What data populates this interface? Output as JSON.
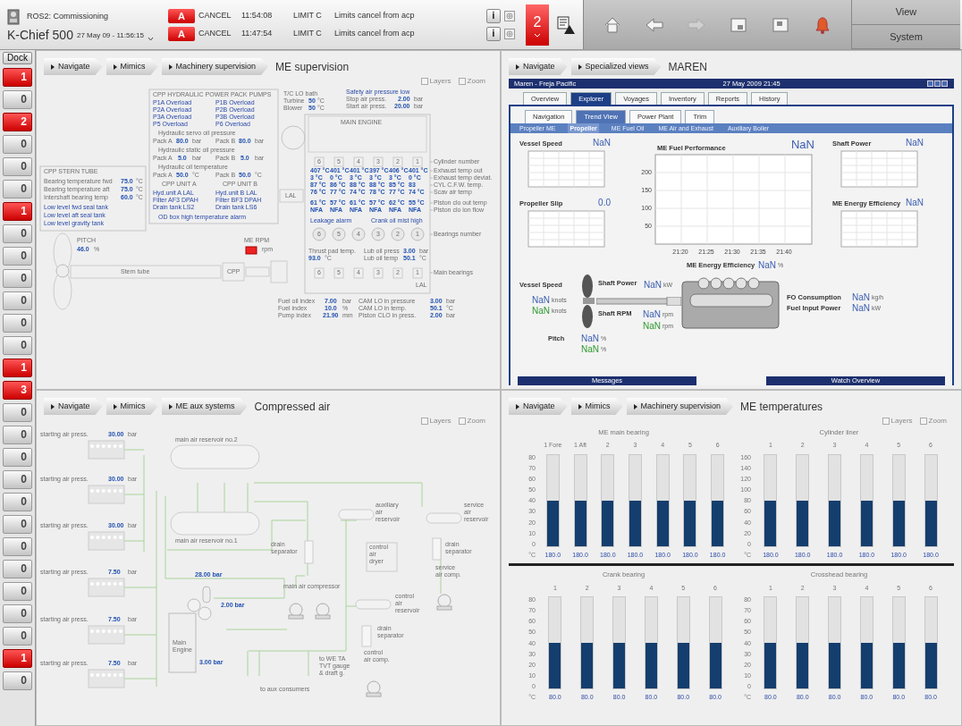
{
  "top_bar": {
    "system": "ROS2: Commissioning",
    "product": "K-Chief 500",
    "datetime": "27 May 09 - 11:56:15",
    "alarms": [
      {
        "badge": "A",
        "action": "CANCEL",
        "time": "11:54:08",
        "type": "LIMIT C",
        "message": "Limits cancel from acp"
      },
      {
        "badge": "A",
        "action": "CANCEL",
        "time": "11:47:54",
        "type": "LIMIT C",
        "message": "Limits cancel from acp"
      }
    ],
    "info": [
      "i",
      "i"
    ],
    "alarm_count": "2",
    "toolbar": [
      {
        "kind": "home",
        "disabled": false
      },
      {
        "kind": "back",
        "disabled": false
      },
      {
        "kind": "forward",
        "disabled": true
      },
      {
        "kind": "window",
        "disabled": false
      },
      {
        "kind": "window-list",
        "disabled": false
      },
      {
        "kind": "bell",
        "disabled": false
      }
    ],
    "menu": [
      "View",
      "System"
    ]
  },
  "dock": {
    "label": "Dock",
    "counters": [
      {
        "count": "1",
        "alarm": true
      },
      {
        "count": "0",
        "alarm": false
      },
      {
        "count": "2",
        "alarm": true
      },
      {
        "count": "0",
        "alarm": false
      },
      {
        "count": "0",
        "alarm": false
      },
      {
        "count": "0",
        "alarm": false
      },
      {
        "count": "1",
        "alarm": true
      },
      {
        "count": "0",
        "alarm": false
      },
      {
        "count": "0",
        "alarm": false
      },
      {
        "count": "0",
        "alarm": false
      },
      {
        "count": "0",
        "alarm": false
      },
      {
        "count": "0",
        "alarm": false
      },
      {
        "count": "0",
        "alarm": false
      },
      {
        "count": "1",
        "alarm": true
      },
      {
        "count": "3",
        "alarm": true
      },
      {
        "count": "0",
        "alarm": false
      },
      {
        "count": "0",
        "alarm": false
      },
      {
        "count": "0",
        "alarm": false
      },
      {
        "count": "0",
        "alarm": false
      },
      {
        "count": "0",
        "alarm": false
      },
      {
        "count": "0",
        "alarm": false
      },
      {
        "count": "0",
        "alarm": false
      },
      {
        "count": "0",
        "alarm": false
      },
      {
        "count": "0",
        "alarm": false
      },
      {
        "count": "0",
        "alarm": false
      },
      {
        "count": "0",
        "alarm": false
      },
      {
        "count": "1",
        "alarm": true
      },
      {
        "count": "0",
        "alarm": false
      }
    ]
  },
  "me_supervision": {
    "breadcrumb": [
      "Navigate",
      "Mimics",
      "Machinery supervision"
    ],
    "title": "ME supervision",
    "options": [
      {
        "label": "Layers",
        "checked": false
      },
      {
        "label": "Zoom",
        "checked": false
      }
    ],
    "labels": [
      {
        "text": "CPP HYDRAULIC POWER PACK PUMPS",
        "kind": "caption"
      },
      {
        "text": "P1A Overload",
        "kind": "alarm"
      },
      {
        "text": "P1B Overload",
        "kind": "alarm"
      },
      {
        "text": "P2A Overload",
        "kind": "alarm"
      },
      {
        "text": "P2B Overload",
        "kind": "alarm"
      },
      {
        "text": "P3A Overload",
        "kind": "alarm"
      },
      {
        "text": "P3B Overload",
        "kind": "alarm"
      },
      {
        "text": "P5 Overload",
        "kind": "alarm"
      },
      {
        "text": "P6 Overload",
        "kind": "alarm"
      },
      {
        "text": "Hydraulic servo oil pressure",
        "kind": "caption"
      },
      {
        "text": "Pack A",
        "kind": "caption"
      },
      {
        "text": "80.0",
        "kind": "value"
      },
      {
        "text": "bar",
        "kind": "unit"
      },
      {
        "text": "Pack B",
        "kind": "caption"
      },
      {
        "text": "80.0",
        "kind": "value"
      },
      {
        "text": "bar",
        "kind": "unit"
      },
      {
        "text": "Hydraulic static oil pressure",
        "kind": "caption"
      },
      {
        "text": "Pack A",
        "kind": "caption"
      },
      {
        "text": "5.0",
        "kind": "value"
      },
      {
        "text": "bar",
        "kind": "unit"
      },
      {
        "text": "Pack B",
        "kind": "caption"
      },
      {
        "text": "5.0",
        "kind": "value"
      },
      {
        "text": "bar",
        "kind": "unit"
      },
      {
        "text": "Hydraulic oil temperature",
        "kind": "caption"
      },
      {
        "text": "Pack A",
        "kind": "caption"
      },
      {
        "text": "50.0",
        "kind": "value"
      },
      {
        "text": "°C",
        "kind": "unit"
      },
      {
        "text": "Pack B",
        "kind": "caption"
      },
      {
        "text": "50.0",
        "kind": "value"
      },
      {
        "text": "°C",
        "kind": "unit"
      },
      {
        "text": "CPP UNIT A",
        "kind": "caption"
      },
      {
        "text": "CPP UNIT B",
        "kind": "caption"
      },
      {
        "text": "Hyd.unit A LAL",
        "kind": "alarm"
      },
      {
        "text": "Hyd.unit B LAL",
        "kind": "alarm"
      },
      {
        "text": "Filter AF3 DPAH",
        "kind": "alarm"
      },
      {
        "text": "Filter BF3 DPAH",
        "kind": "alarm"
      },
      {
        "text": "Drain tank LS2",
        "kind": "alarm"
      },
      {
        "text": "Drain tank LS6",
        "kind": "alarm"
      },
      {
        "text": "OD box high temperature alarm",
        "kind": "alarm"
      },
      {
        "text": "CPP STERN TUBE",
        "kind": "caption"
      },
      {
        "text": "Bearing temperature fwd",
        "kind": "caption"
      },
      {
        "text": "75.0",
        "kind": "value"
      },
      {
        "text": "°C",
        "kind": "unit"
      },
      {
        "text": "Bearing temperature aft",
        "kind": "caption"
      },
      {
        "text": "75.0",
        "kind": "value"
      },
      {
        "text": "°C",
        "kind": "unit"
      },
      {
        "text": "Intershaft bearing temp",
        "kind": "caption"
      },
      {
        "text": "60.0",
        "kind": "value"
      },
      {
        "text": "°C",
        "kind": "unit"
      },
      {
        "text": "Low level fwd seal tank",
        "kind": "alarm"
      },
      {
        "text": "Low level aft seal tank",
        "kind": "alarm"
      },
      {
        "text": "Low level gravity tank",
        "kind": "alarm"
      },
      {
        "text": "PITCH",
        "kind": "caption"
      },
      {
        "text": "46.0",
        "kind": "value"
      },
      {
        "text": "%",
        "kind": "unit"
      },
      {
        "text": "ME RPM",
        "kind": "caption"
      },
      {
        "text": "rpm",
        "kind": "unit"
      },
      {
        "text": "Stern tube",
        "kind": "caption"
      },
      {
        "text": "CPP",
        "kind": "caption"
      },
      {
        "text": "T/C LO bath",
        "kind": "caption"
      },
      {
        "text": "Turbine",
        "kind": "caption"
      },
      {
        "text": "50",
        "kind": "value"
      },
      {
        "text": "°C",
        "kind": "unit"
      },
      {
        "text": "Blower",
        "kind": "caption"
      },
      {
        "text": "50",
        "kind": "value"
      },
      {
        "text": "°C",
        "kind": "unit"
      },
      {
        "text": "Safety air pressure low",
        "kind": "alarm"
      },
      {
        "text": "Stop air press.",
        "kind": "caption"
      },
      {
        "text": "2.00",
        "kind": "value"
      },
      {
        "text": "bar",
        "kind": "unit"
      },
      {
        "text": "Start air press.",
        "kind": "caption"
      },
      {
        "text": "20.00",
        "kind": "value"
      },
      {
        "text": "bar",
        "kind": "unit"
      },
      {
        "text": "MAIN ENGINE",
        "kind": "caption"
      },
      {
        "text": "Cylinder number",
        "kind": "caption"
      },
      {
        "text": "Exhaust temp out",
        "kind": "caption"
      },
      {
        "text": "Exhaust temp deviat.",
        "kind": "caption"
      },
      {
        "text": "CYL C.F.W. temp.",
        "kind": "caption"
      },
      {
        "text": "Scav air temp",
        "kind": "caption"
      },
      {
        "text": "Piston clo out temp",
        "kind": "caption"
      },
      {
        "text": "Piston clo ion flow",
        "kind": "caption"
      },
      {
        "text": "Bearings number",
        "kind": "caption"
      },
      {
        "text": "Main bearings",
        "kind": "caption"
      },
      {
        "text": "Leakage alarm",
        "kind": "alarm"
      },
      {
        "text": "Crank oil mist high",
        "kind": "alarm"
      },
      {
        "text": "Thrust pad temp.",
        "kind": "caption"
      },
      {
        "text": "93.0",
        "kind": "value"
      },
      {
        "text": "°C",
        "kind": "unit"
      },
      {
        "text": "Lub oil press",
        "kind": "caption"
      },
      {
        "text": "3.00",
        "kind": "value"
      },
      {
        "text": "bar",
        "kind": "unit"
      },
      {
        "text": "Lub oil temp",
        "kind": "caption"
      },
      {
        "text": "50.1",
        "kind": "value"
      },
      {
        "text": "°C",
        "kind": "unit"
      },
      {
        "text": "Fuel oil index",
        "kind": "caption"
      },
      {
        "text": "7.00",
        "kind": "value"
      },
      {
        "text": "bar",
        "kind": "unit"
      },
      {
        "text": "Fuel index",
        "kind": "caption"
      },
      {
        "text": "10.0",
        "kind": "value"
      },
      {
        "text": "%",
        "kind": "unit"
      },
      {
        "text": "Pump index",
        "kind": "caption"
      },
      {
        "text": "21.90",
        "kind": "value"
      },
      {
        "text": "mm",
        "kind": "unit"
      },
      {
        "text": "CAM LO in pressure",
        "kind": "caption"
      },
      {
        "text": "3.00",
        "kind": "value"
      },
      {
        "text": "bar",
        "kind": "unit"
      },
      {
        "text": "CAM LO in temp.",
        "kind": "caption"
      },
      {
        "text": "50.1",
        "kind": "value"
      },
      {
        "text": "°C",
        "kind": "unit"
      },
      {
        "text": "Piston CLO in press.",
        "kind": "caption"
      },
      {
        "text": "2.00",
        "kind": "value"
      },
      {
        "text": "bar",
        "kind": "unit"
      },
      {
        "text": "LAL",
        "kind": "caption"
      },
      {
        "text": "LAL",
        "kind": "caption"
      }
    ],
    "engine_table": {
      "cylinders": [
        "6",
        "5",
        "4",
        "3",
        "2",
        "1"
      ],
      "rows": [
        [
          "407 °C",
          "401 °C",
          "401 °C",
          "397 °C",
          "406 °C",
          "401 °C"
        ],
        [
          "3 °C",
          "0 °C",
          "3 °C",
          "3 °C",
          "3 °C",
          "0 °C"
        ],
        [
          "87 °C",
          "86 °C",
          "88 °C",
          "88 °C",
          "85 °C",
          "83"
        ],
        [
          "76 °C",
          "77 °C",
          "74 °C",
          "78 °C",
          "77 °C",
          "74 °C"
        ],
        [
          "61 °C",
          "57 °C",
          "61 °C",
          "57 °C",
          "62 °C",
          "55 °C"
        ],
        [
          "NFA",
          "NFA",
          "NFA",
          "NFA",
          "NFA",
          "NFA"
        ]
      ],
      "bearings": [
        "6",
        "5",
        "4",
        "3",
        "2",
        "1"
      ],
      "main_bearings": [
        "6",
        "5",
        "4",
        "3",
        "2",
        "1"
      ]
    },
    "rpm_alarm": true
  },
  "maren": {
    "breadcrumb": [
      "Navigate",
      "Specialized views"
    ],
    "title": "MAREN",
    "app_title": "Maren - Freja Pacific",
    "app_datetime": "27 May 2009 21:45",
    "tabs": [
      {
        "label": "Overview",
        "selected": false
      },
      {
        "label": "Explorer",
        "selected": true
      },
      {
        "label": "Voyages",
        "selected": false
      },
      {
        "label": "Inventory",
        "selected": false
      },
      {
        "label": "Reports",
        "selected": false
      },
      {
        "label": "History",
        "selected": false
      }
    ],
    "subtabs": [
      {
        "label": "Navigation",
        "selected": false
      },
      {
        "label": "Trend View",
        "selected": true
      },
      {
        "label": "Power Plant",
        "selected": false
      },
      {
        "label": "Trim",
        "selected": false
      }
    ],
    "views": [
      {
        "label": "Propeller ME",
        "selected": false
      },
      {
        "label": "Propeller",
        "selected": true
      },
      {
        "label": "ME Fuel Oil",
        "selected": false
      },
      {
        "label": "ME Air and Exhaust",
        "selected": false
      },
      {
        "label": "Auxiliary Boiler",
        "selected": false
      }
    ],
    "trends": [
      {
        "title": "Vessel Speed",
        "value": "NaN"
      },
      {
        "title": "Propeller Slip",
        "value": "0.0"
      },
      {
        "title": "ME Fuel Performance",
        "value": "NaN",
        "yticks": [
          "200",
          "150",
          "100",
          "50"
        ],
        "xticks": [
          "21:20",
          "21:25",
          "21:30",
          "21:35",
          "21:40"
        ]
      },
      {
        "title": "Shaft Power",
        "value": "NaN"
      },
      {
        "title": "ME Energy Efficiency",
        "value": "NaN"
      }
    ],
    "readings": [
      {
        "label": "Vessel Speed",
        "values": [
          {
            "value": "NaN",
            "unit": "knots",
            "kind": "measured"
          },
          {
            "value": "NaN",
            "unit": "knots",
            "kind": "reference"
          }
        ]
      },
      {
        "label": "Shaft Power",
        "values": [
          {
            "value": "NaN",
            "unit": "kW",
            "kind": "measured"
          }
        ]
      },
      {
        "label": "Shaft RPM",
        "values": [
          {
            "value": "NaN",
            "unit": "rpm",
            "kind": "measured"
          },
          {
            "value": "NaN",
            "unit": "rpm",
            "kind": "reference"
          }
        ]
      },
      {
        "label": "Pitch",
        "values": [
          {
            "value": "NaN",
            "unit": "%",
            "kind": "measured"
          },
          {
            "value": "NaN",
            "unit": "%",
            "kind": "reference"
          }
        ]
      },
      {
        "label": "ME Energy Efficiency",
        "values": [
          {
            "value": "NaN",
            "unit": "%",
            "kind": "measured"
          }
        ]
      },
      {
        "label": "FO Consumption",
        "values": [
          {
            "value": "NaN",
            "unit": "kg/h",
            "kind": "measured"
          }
        ]
      },
      {
        "label": "Fuel Input Power",
        "values": [
          {
            "value": "NaN",
            "unit": "kW",
            "kind": "measured"
          }
        ]
      }
    ],
    "footer": [
      "Messages",
      "Watch Overview"
    ]
  },
  "compressed_air": {
    "breadcrumb": [
      "Navigate",
      "Mimics",
      "ME aux systems"
    ],
    "title": "Compressed air",
    "options": [
      {
        "label": "Layers",
        "checked": false
      },
      {
        "label": "Zoom",
        "checked": false
      }
    ],
    "starting_air": [
      {
        "label": "starting air press.",
        "value": "30.00",
        "unit": "bar"
      },
      {
        "label": "starting air press.",
        "value": "30.00",
        "unit": "bar"
      },
      {
        "label": "starting air press.",
        "value": "30.00",
        "unit": "bar"
      },
      {
        "label": "starting air press.",
        "value": "7.50",
        "unit": "bar"
      },
      {
        "label": "starting air press.",
        "value": "7.50",
        "unit": "bar"
      },
      {
        "label": "starting air press.",
        "value": "7.50",
        "unit": "bar"
      }
    ],
    "labels": [
      {
        "lines": [
          "main air reservoir no.2"
        ]
      },
      {
        "lines": [
          "main air reservoir no.1"
        ]
      },
      {
        "lines": [
          "auxiliary",
          "air",
          "reservoir"
        ]
      },
      {
        "lines": [
          "service",
          "air",
          "reservoir"
        ]
      },
      {
        "lines": [
          "drain",
          "separator"
        ]
      },
      {
        "lines": [
          "control",
          "air",
          "dryer"
        ]
      },
      {
        "lines": [
          "drain",
          "separator"
        ]
      },
      {
        "lines": [
          "service",
          "air comp."
        ]
      },
      {
        "lines": [
          "main air compressor"
        ]
      },
      {
        "lines": [
          "control",
          "air",
          "reservoir"
        ]
      },
      {
        "lines": [
          "drain",
          "separator"
        ]
      },
      {
        "lines": [
          "control",
          "air comp."
        ]
      },
      {
        "lines": [
          "to aux consumers"
        ]
      },
      {
        "lines": [
          "to WE TA",
          "TVT gauge",
          "& draft g."
        ]
      },
      {
        "lines": [
          "Main",
          "Engine"
        ]
      }
    ],
    "pressures": [
      "28.00 bar",
      "2.00 bar",
      "3.00 bar"
    ]
  },
  "me_temperatures": {
    "breadcrumb": [
      "Navigate",
      "Mimics",
      "Machinery supervision"
    ],
    "title": "ME temperatures",
    "options": [
      {
        "label": "Layers",
        "checked": false
      },
      {
        "label": "Zoom",
        "checked": false
      }
    ],
    "groups": [
      {
        "title": "ME main bearing",
        "unit": "°C",
        "yticks": [
          "80",
          "70",
          "60",
          "50",
          "40",
          "30",
          "20",
          "10",
          "0"
        ],
        "bars": [
          {
            "label": "1 Fore",
            "level": 0.5,
            "reading": "180.0"
          },
          {
            "label": "1 Aft",
            "level": 0.5,
            "reading": "180.0"
          },
          {
            "label": "2",
            "level": 0.5,
            "reading": "180.0"
          },
          {
            "label": "3",
            "level": 0.5,
            "reading": "180.0"
          },
          {
            "label": "4",
            "level": 0.5,
            "reading": "180.0"
          },
          {
            "label": "5",
            "level": 0.5,
            "reading": "180.0"
          },
          {
            "label": "6",
            "level": 0.5,
            "reading": "180.0"
          }
        ]
      },
      {
        "title": "Cylinder liner",
        "unit": "°C",
        "yticks": [
          "160",
          "140",
          "120",
          "100",
          "80",
          "60",
          "40",
          "20",
          "0"
        ],
        "bars": [
          {
            "label": "1",
            "level": 0.5,
            "reading": "180.0"
          },
          {
            "label": "2",
            "level": 0.5,
            "reading": "180.0"
          },
          {
            "label": "3",
            "level": 0.5,
            "reading": "180.0"
          },
          {
            "label": "4",
            "level": 0.5,
            "reading": "180.0"
          },
          {
            "label": "5",
            "level": 0.5,
            "reading": "180.0"
          },
          {
            "label": "6",
            "level": 0.5,
            "reading": "180.0"
          }
        ]
      },
      {
        "title": "Crank bearing",
        "unit": "°C",
        "yticks": [
          "80",
          "70",
          "60",
          "50",
          "40",
          "30",
          "20",
          "10",
          "0"
        ],
        "bars": [
          {
            "label": "1",
            "level": 0.5,
            "reading": "80.0"
          },
          {
            "label": "2",
            "level": 0.5,
            "reading": "80.0"
          },
          {
            "label": "3",
            "level": 0.5,
            "reading": "80.0"
          },
          {
            "label": "4",
            "level": 0.5,
            "reading": "80.0"
          },
          {
            "label": "5",
            "level": 0.5,
            "reading": "80.0"
          },
          {
            "label": "6",
            "level": 0.5,
            "reading": "80.0"
          }
        ]
      },
      {
        "title": "Crosshead bearing",
        "unit": "°C",
        "yticks": [
          "80",
          "70",
          "60",
          "50",
          "40",
          "30",
          "20",
          "10",
          "0"
        ],
        "bars": [
          {
            "label": "1",
            "level": 0.5,
            "reading": "80.0"
          },
          {
            "label": "2",
            "level": 0.5,
            "reading": "80.0"
          },
          {
            "label": "3",
            "level": 0.5,
            "reading": "80.0"
          },
          {
            "label": "4",
            "level": 0.5,
            "reading": "80.0"
          },
          {
            "label": "5",
            "level": 0.5,
            "reading": "80.0"
          },
          {
            "label": "6",
            "level": 0.5,
            "reading": "80.0"
          }
        ]
      }
    ]
  }
}
